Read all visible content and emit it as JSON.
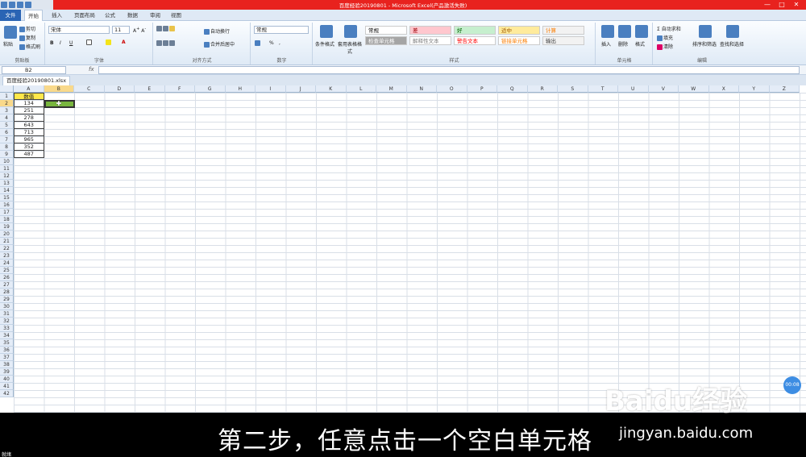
{
  "window": {
    "title": "百度经验20190801 - Microsoft Excel(产品激活失败)",
    "minimize": "—",
    "maximize": "□",
    "close": "✕"
  },
  "tabs": {
    "file": "文件",
    "items": [
      "开始",
      "插入",
      "页面布局",
      "公式",
      "数据",
      "审阅",
      "视图"
    ]
  },
  "ribbon": {
    "clipboard": {
      "paste": "粘贴",
      "cut": "剪切",
      "copy": "复制",
      "format_painter": "格式刷",
      "label": "剪贴板"
    },
    "font": {
      "name": "宋体",
      "size": "11",
      "bold": "B",
      "italic": "I",
      "underline": "U",
      "label": "字体"
    },
    "alignment": {
      "wrap": "自动换行",
      "merge": "合并后居中",
      "label": "对齐方式"
    },
    "number": {
      "format": "常规",
      "percent": "%",
      "comma": ",",
      "label": "数字"
    },
    "styles": {
      "conditional": "条件格式",
      "table": "套用表格格式",
      "cells": [
        {
          "text": "常规",
          "bg": "#ffffff",
          "fg": "#000000"
        },
        {
          "text": "差",
          "bg": "#ffc7ce",
          "fg": "#9c0006"
        },
        {
          "text": "好",
          "bg": "#c6efce",
          "fg": "#006100"
        },
        {
          "text": "适中",
          "bg": "#ffeb9c",
          "fg": "#9c5700"
        },
        {
          "text": "计算",
          "bg": "#f2f2f2",
          "fg": "#fa7d00"
        },
        {
          "text": "检查单元格",
          "bg": "#a5a5a5",
          "fg": "#ffffff"
        },
        {
          "text": "解释性文本",
          "bg": "#ffffff",
          "fg": "#7f7f7f"
        },
        {
          "text": "警告文本",
          "bg": "#ffffff",
          "fg": "#ff0000"
        },
        {
          "text": "链接单元格",
          "bg": "#ffffff",
          "fg": "#fa7d00"
        },
        {
          "text": "输出",
          "bg": "#f2f2f2",
          "fg": "#3f3f3f"
        }
      ],
      "label": "样式"
    },
    "cells_group": {
      "insert": "插入",
      "delete": "删除",
      "format": "格式",
      "label": "单元格"
    },
    "editing": {
      "autosum": "自动求和",
      "fill": "填充",
      "clear": "清除",
      "sort": "排序和筛选",
      "find": "查找和选择",
      "label": "编辑"
    }
  },
  "formula_bar": {
    "name_box": "B2",
    "fx": "fx",
    "value": ""
  },
  "workbook_tab": "百度经验20190801.xlsx",
  "sheet": {
    "columns": [
      "A",
      "B",
      "C",
      "D",
      "E",
      "F",
      "G",
      "H",
      "I",
      "J",
      "K",
      "L",
      "M",
      "N",
      "O",
      "P",
      "Q",
      "R",
      "S",
      "T",
      "U",
      "V",
      "W",
      "X",
      "Y",
      "Z"
    ],
    "row_count": 42,
    "header": "数值",
    "values": [
      "134",
      "251",
      "278",
      "643",
      "713",
      "965",
      "352",
      "487"
    ],
    "selected_cell": "B2"
  },
  "overlay": {
    "subtitle": "第二步，任意点击一个空白单元格",
    "watermark_logo": "Baidu经验",
    "watermark_url": "jingyan.baidu.com",
    "timer": "00:08",
    "status": "就绪"
  }
}
